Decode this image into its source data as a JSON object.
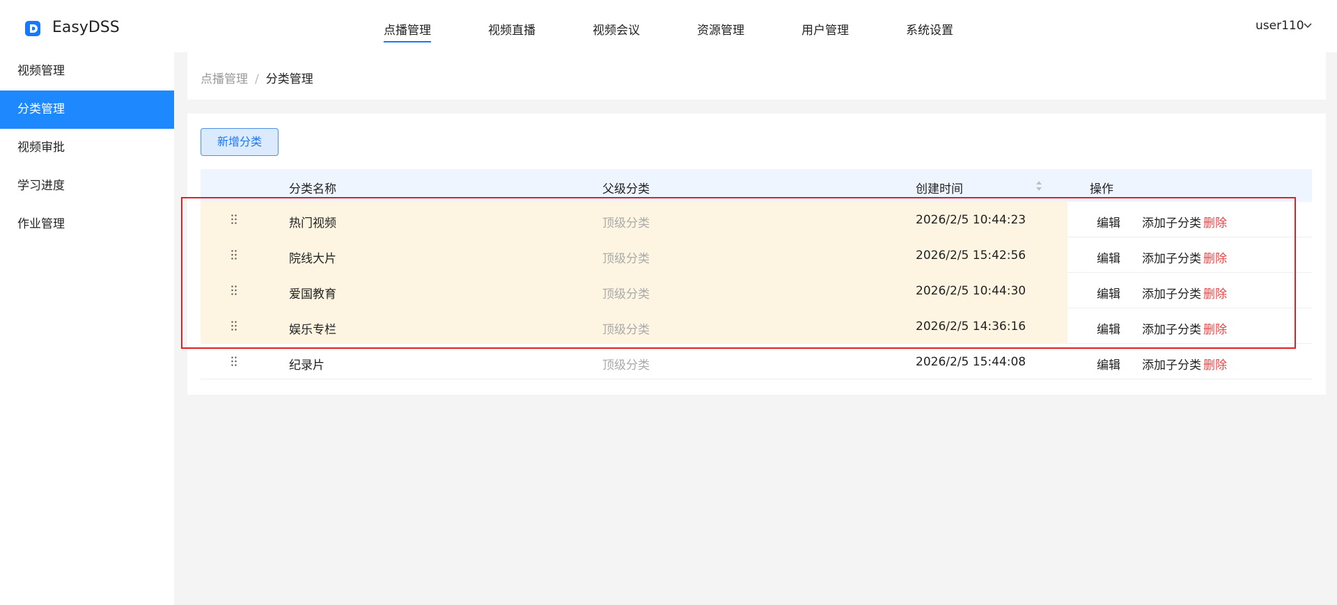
{
  "brand": {
    "name": "EasyDSS",
    "logo_color": "#1677ff"
  },
  "nav": [
    {
      "label": "点播管理",
      "active": true
    },
    {
      "label": "视频直播"
    },
    {
      "label": "视频会议"
    },
    {
      "label": "资源管理"
    },
    {
      "label": "用户管理"
    },
    {
      "label": "系统设置"
    }
  ],
  "user": {
    "name": "user110",
    "icon": "chevron-down-icon"
  },
  "sidebar": {
    "items": [
      {
        "label": "视频管理"
      },
      {
        "label": "分类管理",
        "active": true
      },
      {
        "label": "视频审批"
      },
      {
        "label": "学习进度"
      },
      {
        "label": "作业管理"
      }
    ]
  },
  "breadcrumb": {
    "parent": "点播管理",
    "separator": "/",
    "current": "分类管理"
  },
  "toolbar": {
    "add_label": "新增分类"
  },
  "table": {
    "headers": {
      "name": "分类名称",
      "parent": "父级分类",
      "created": "创建时间",
      "actions": "操作"
    },
    "rows": [
      {
        "name": "热门视频",
        "parent": "顶级分类",
        "created": "2026/2/5 10:44:23",
        "edit": "编辑",
        "add_sub": "添加子分类",
        "delete": "删除",
        "highlighted": true
      },
      {
        "name": "院线大片",
        "parent": "顶级分类",
        "created": "2026/2/5 15:42:56",
        "edit": "编辑",
        "add_sub": "添加子分类",
        "delete": "删除",
        "highlighted": true
      },
      {
        "name": "爱国教育",
        "parent": "顶级分类",
        "created": "2026/2/5 10:44:30",
        "edit": "编辑",
        "add_sub": "添加子分类",
        "delete": "删除",
        "highlighted": true
      },
      {
        "name": "娱乐专栏",
        "parent": "顶级分类",
        "created": "2026/2/5 14:36:16",
        "edit": "编辑",
        "add_sub": "添加子分类",
        "delete": "删除",
        "highlighted": true
      },
      {
        "name": "纪录片",
        "parent": "顶级分类",
        "created": "2026/2/5 15:44:08",
        "edit": "编辑",
        "add_sub": "添加子分类",
        "delete": "删除",
        "highlighted": false
      }
    ]
  },
  "colors": {
    "accent": "#1677ff",
    "sidebar_active": "#1e88ff",
    "highlight": "#fdf5e2",
    "delete": "#f04545",
    "outline": "#e02020"
  }
}
